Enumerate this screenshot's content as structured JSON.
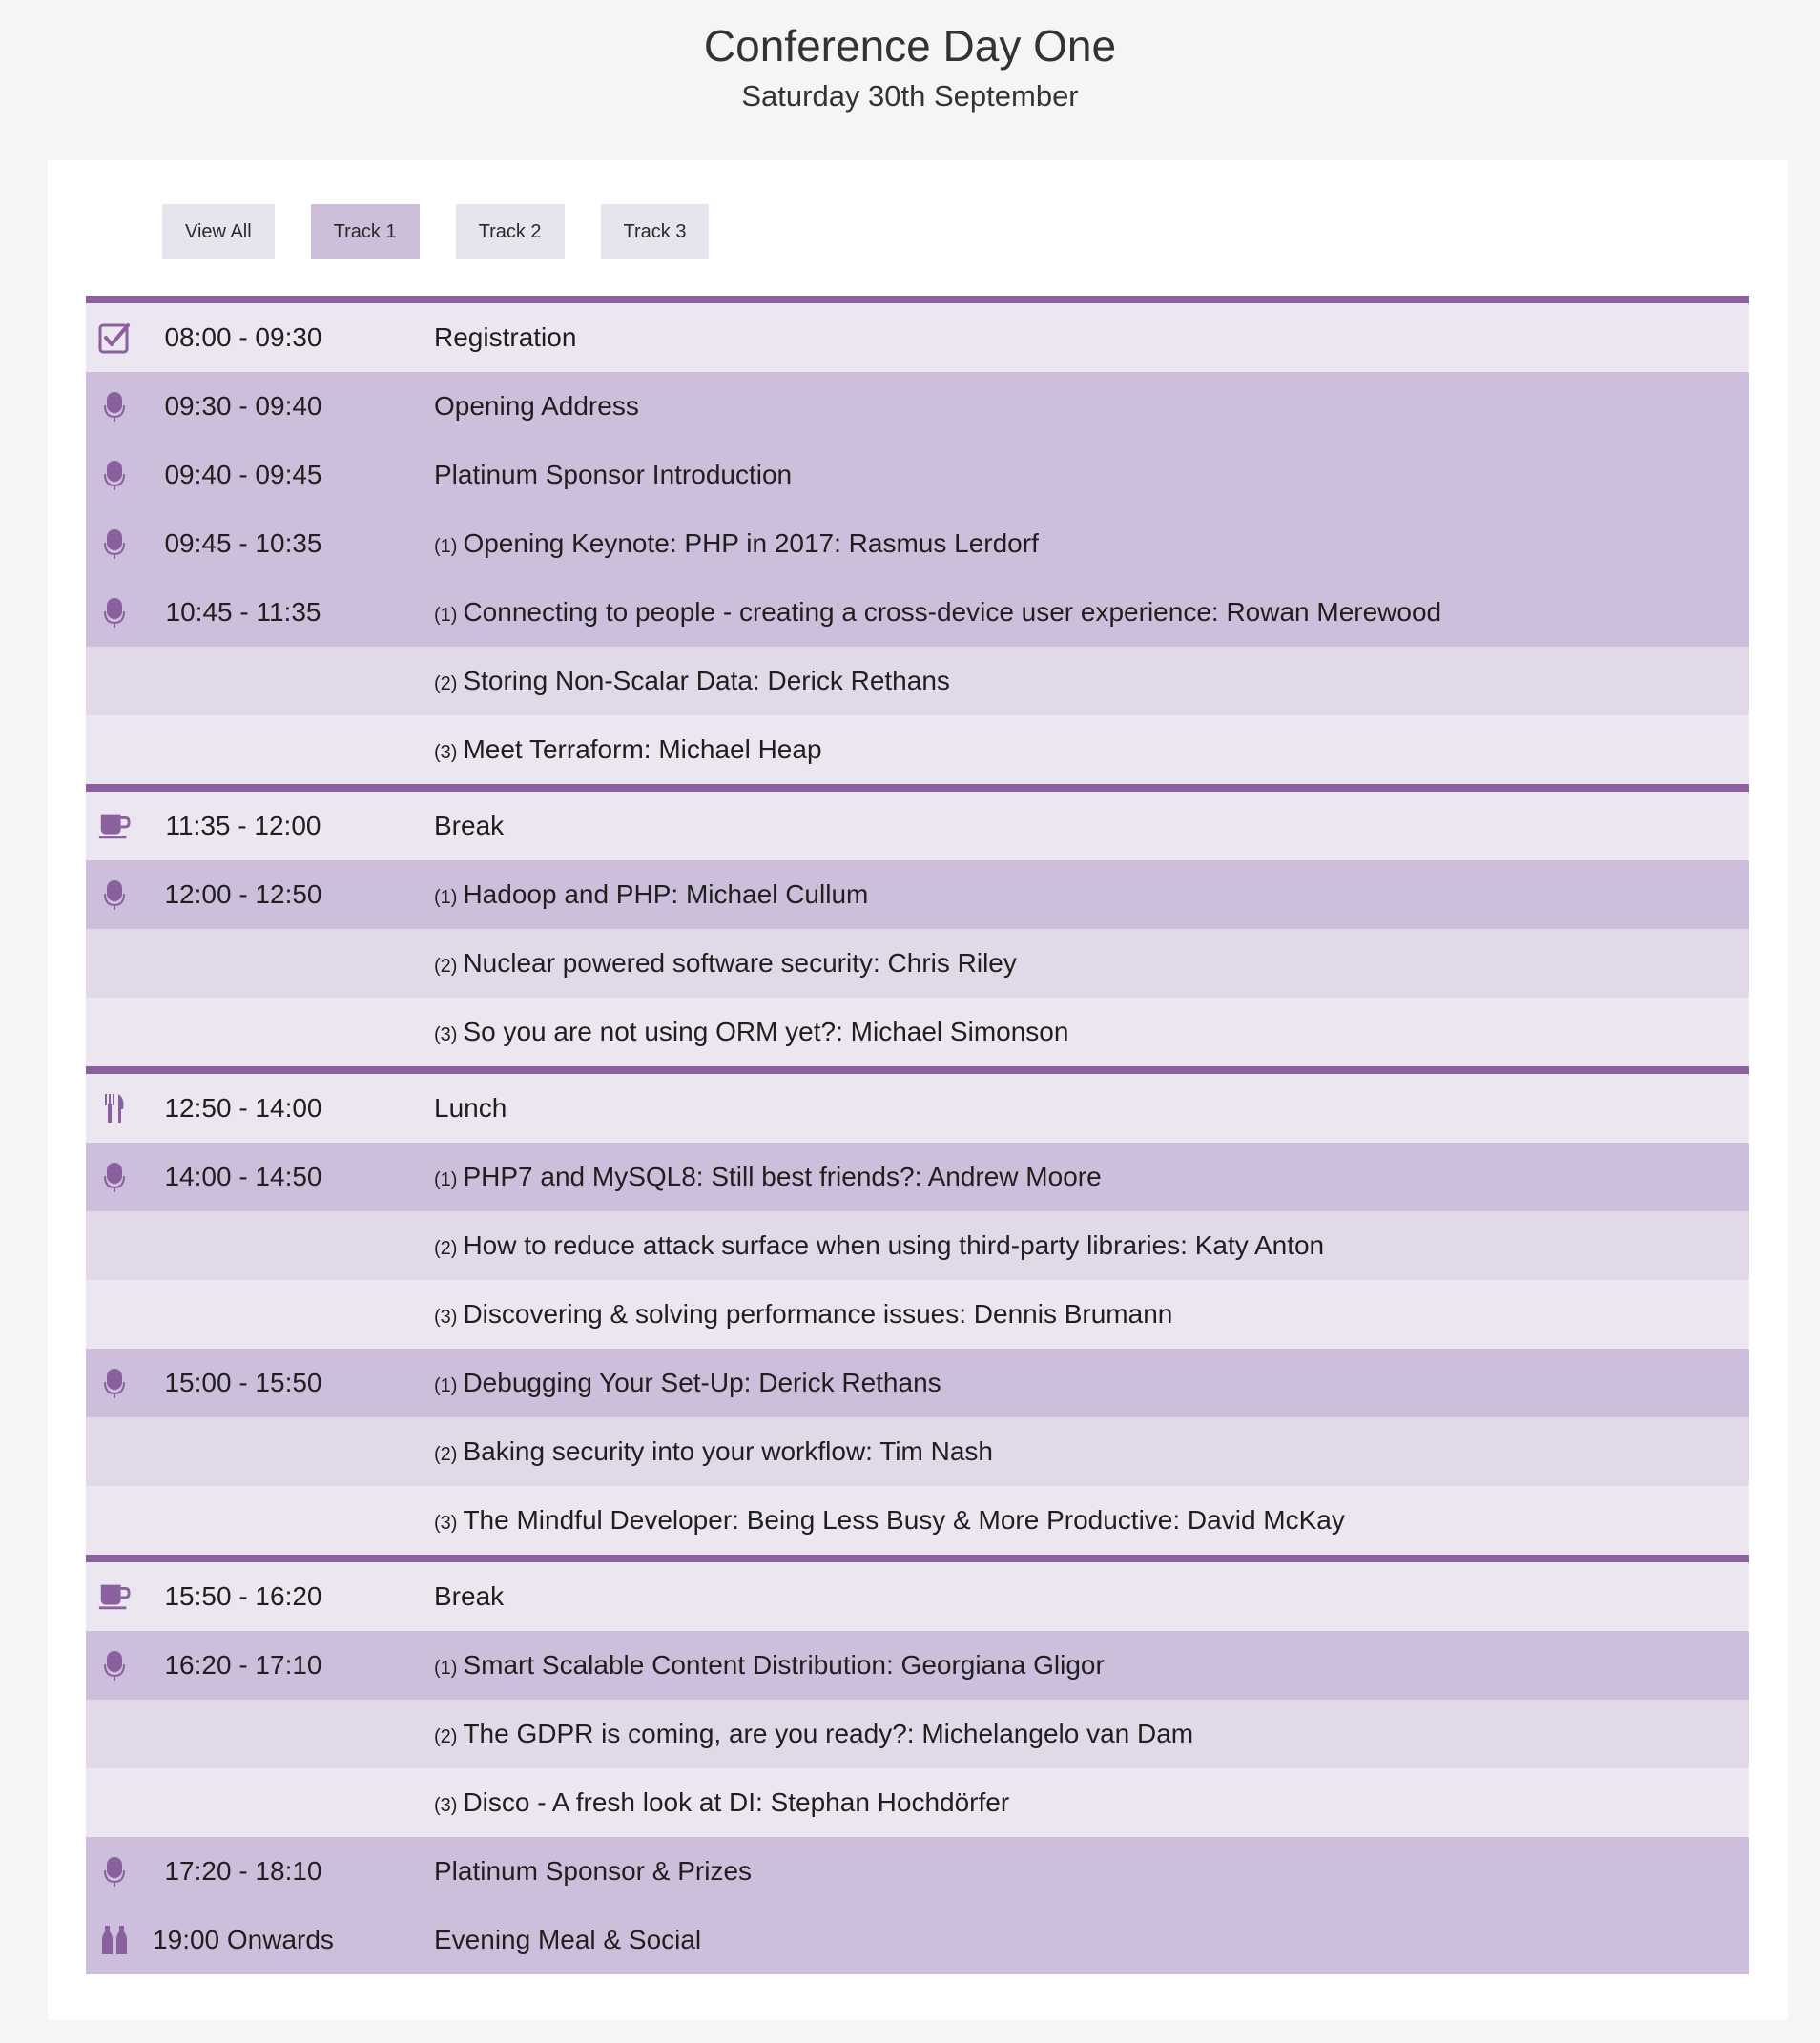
{
  "header": {
    "title": "Conference Day One",
    "subtitle": "Saturday 30th September"
  },
  "filters": [
    {
      "label": "View All",
      "active": false
    },
    {
      "label": "Track 1",
      "active": true
    },
    {
      "label": "Track 2",
      "active": false
    },
    {
      "label": "Track 3",
      "active": false
    }
  ],
  "colors": {
    "accent": "#8a609f",
    "row_light": "#ebe6f0",
    "row_mid": "#e1d8e8",
    "row_dark": "#cdbfdb",
    "icon": "#8a609f"
  },
  "schedule": [
    {
      "icon": "checkbox-icon",
      "time": "08:00 - 09:30",
      "track": "",
      "title": "Registration",
      "bg": "light",
      "group_start": true
    },
    {
      "icon": "microphone-icon",
      "time": "09:30 - 09:40",
      "track": "",
      "title": "Opening Address",
      "bg": "dark",
      "group_start": false
    },
    {
      "icon": "microphone-icon",
      "time": "09:40 - 09:45",
      "track": "",
      "title": "Platinum Sponsor Introduction",
      "bg": "dark",
      "group_start": false
    },
    {
      "icon": "microphone-icon",
      "time": "09:45 - 10:35",
      "track": "(1)",
      "title": "Opening Keynote: PHP in 2017: Rasmus Lerdorf",
      "bg": "dark",
      "group_start": false
    },
    {
      "icon": "microphone-icon",
      "time": "10:45 - 11:35",
      "track": "(1)",
      "title": "Connecting to people - creating a cross-device user experience: Rowan Merewood",
      "bg": "dark",
      "group_start": false
    },
    {
      "icon": "",
      "time": "",
      "track": "(2)",
      "title": "Storing Non-Scalar Data: Derick Rethans",
      "bg": "mid",
      "group_start": false
    },
    {
      "icon": "",
      "time": "",
      "track": "(3)",
      "title": "Meet Terraform: Michael Heap",
      "bg": "light",
      "group_start": false
    },
    {
      "icon": "coffee-cup-icon",
      "time": "11:35 - 12:00",
      "track": "",
      "title": "Break",
      "bg": "light",
      "group_start": true
    },
    {
      "icon": "microphone-icon",
      "time": "12:00 - 12:50",
      "track": "(1)",
      "title": "Hadoop and PHP: Michael Cullum",
      "bg": "dark",
      "group_start": false
    },
    {
      "icon": "",
      "time": "",
      "track": "(2)",
      "title": "Nuclear powered software security: Chris Riley",
      "bg": "mid",
      "group_start": false
    },
    {
      "icon": "",
      "time": "",
      "track": "(3)",
      "title": "So you are not using ORM yet?: Michael Simonson",
      "bg": "light",
      "group_start": false
    },
    {
      "icon": "cutlery-icon",
      "time": "12:50 - 14:00",
      "track": "",
      "title": "Lunch",
      "bg": "light",
      "group_start": true
    },
    {
      "icon": "microphone-icon",
      "time": "14:00 - 14:50",
      "track": "(1)",
      "title": "PHP7 and MySQL8: Still best friends?: Andrew Moore",
      "bg": "dark",
      "group_start": false
    },
    {
      "icon": "",
      "time": "",
      "track": "(2)",
      "title": "How to reduce attack surface when using third-party libraries: Katy Anton",
      "bg": "mid",
      "group_start": false
    },
    {
      "icon": "",
      "time": "",
      "track": "(3)",
      "title": "Discovering & solving performance issues: Dennis Brumann",
      "bg": "light",
      "group_start": false
    },
    {
      "icon": "microphone-icon",
      "time": "15:00 - 15:50",
      "track": "(1)",
      "title": "Debugging Your Set-Up: Derick Rethans",
      "bg": "dark",
      "group_start": false
    },
    {
      "icon": "",
      "time": "",
      "track": "(2)",
      "title": "Baking security into your workflow: Tim Nash",
      "bg": "mid",
      "group_start": false
    },
    {
      "icon": "",
      "time": "",
      "track": "(3)",
      "title": "The Mindful Developer: Being Less Busy & More Productive: David McKay",
      "bg": "light",
      "group_start": false
    },
    {
      "icon": "coffee-cup-icon",
      "time": "15:50 - 16:20",
      "track": "",
      "title": "Break",
      "bg": "light",
      "group_start": true
    },
    {
      "icon": "microphone-icon",
      "time": "16:20 - 17:10",
      "track": "(1)",
      "title": "Smart Scalable Content Distribution: Georgiana Gligor",
      "bg": "dark",
      "group_start": false
    },
    {
      "icon": "",
      "time": "",
      "track": "(2)",
      "title": "The GDPR is coming, are you ready?: Michelangelo van Dam",
      "bg": "mid",
      "group_start": false
    },
    {
      "icon": "",
      "time": "",
      "track": "(3)",
      "title": "Disco - A fresh look at DI: Stephan Hochdörfer",
      "bg": "light",
      "group_start": false
    },
    {
      "icon": "microphone-icon",
      "time": "17:20 - 18:10",
      "track": "",
      "title": "Platinum Sponsor & Prizes",
      "bg": "dark",
      "group_start": false
    },
    {
      "icon": "bottles-icon",
      "time": "19:00 Onwards",
      "track": "",
      "title": "Evening Meal & Social",
      "bg": "dark",
      "group_start": false
    }
  ]
}
